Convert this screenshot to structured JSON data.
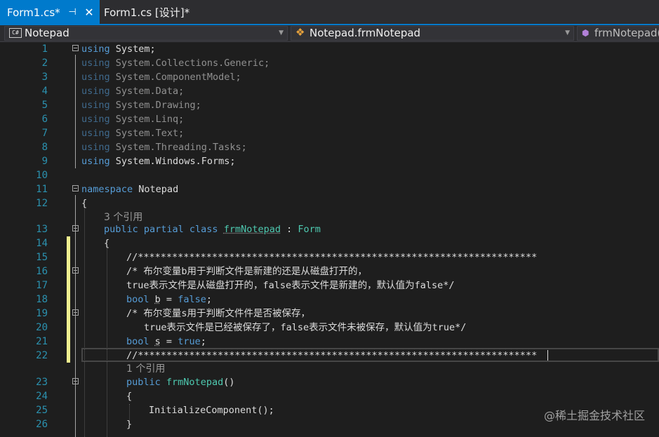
{
  "tabs": [
    {
      "label": "Form1.cs*",
      "active": true
    },
    {
      "label": "Form1.cs [设计]*",
      "active": false
    }
  ],
  "tab_icons": {
    "pin": "pin-icon",
    "close": "close-icon"
  },
  "navbar": {
    "project": "Notepad",
    "type": "Notepad.frmNotepad",
    "member": "frmNotepad()",
    "project_icon_text": "C#"
  },
  "codelens": {
    "class_refs": "3 个引用",
    "ctor_refs": "1 个引用"
  },
  "code": {
    "using_kw": "using",
    "usings": [
      "System;",
      "System.Collections.Generic;",
      "System.ComponentModel;",
      "System.Data;",
      "System.Drawing;",
      "System.Linq;",
      "System.Text;",
      "System.Threading.Tasks;",
      "System.Windows.Forms;"
    ],
    "namespace_kw": "namespace",
    "namespace_name": "Notepad",
    "open_brace": "{",
    "close_brace": "}",
    "class_kw": "public partial class",
    "class_name": "frmNotepad",
    "class_colon": " : ",
    "base_class": "Form",
    "comment_stars": "//**********************************************************************",
    "comment_b_1": "/* 布尔变量b用于判断文件是新建的还是从磁盘打开的，",
    "comment_b_2": "true表示文件是从磁盘打开的，false表示文件是新建的，默认值为false*/",
    "bool_kw": "bool",
    "var_b": "b",
    "assign": " = ",
    "false_kw": "false",
    "true_kw": "true",
    "semi": ";",
    "comment_s_1": "/* 布尔变量s用于判断文件件是否被保存，",
    "comment_s_2": "true表示文件是已经被保存了，false表示文件未被保存，默认值为true*/",
    "var_s": "s",
    "ctor_kw": "public",
    "ctor_name": "frmNotepad",
    "ctor_parens": "()",
    "init_call": "InitializeComponent();"
  },
  "line_numbers": [
    "1",
    "2",
    "3",
    "4",
    "5",
    "6",
    "7",
    "8",
    "9",
    "10",
    "11",
    "12",
    "13",
    "14",
    "15",
    "16",
    "17",
    "18",
    "19",
    "20",
    "21",
    "22",
    "23",
    "24",
    "25",
    "26"
  ],
  "colors": {
    "keyword": "#569cd6",
    "type": "#4ec9b0",
    "comment": "#57a64a",
    "line_number": "#2b91af",
    "accent": "#007acc",
    "change_marker": "#efef8f"
  },
  "watermark": "@稀土掘金技术社区"
}
